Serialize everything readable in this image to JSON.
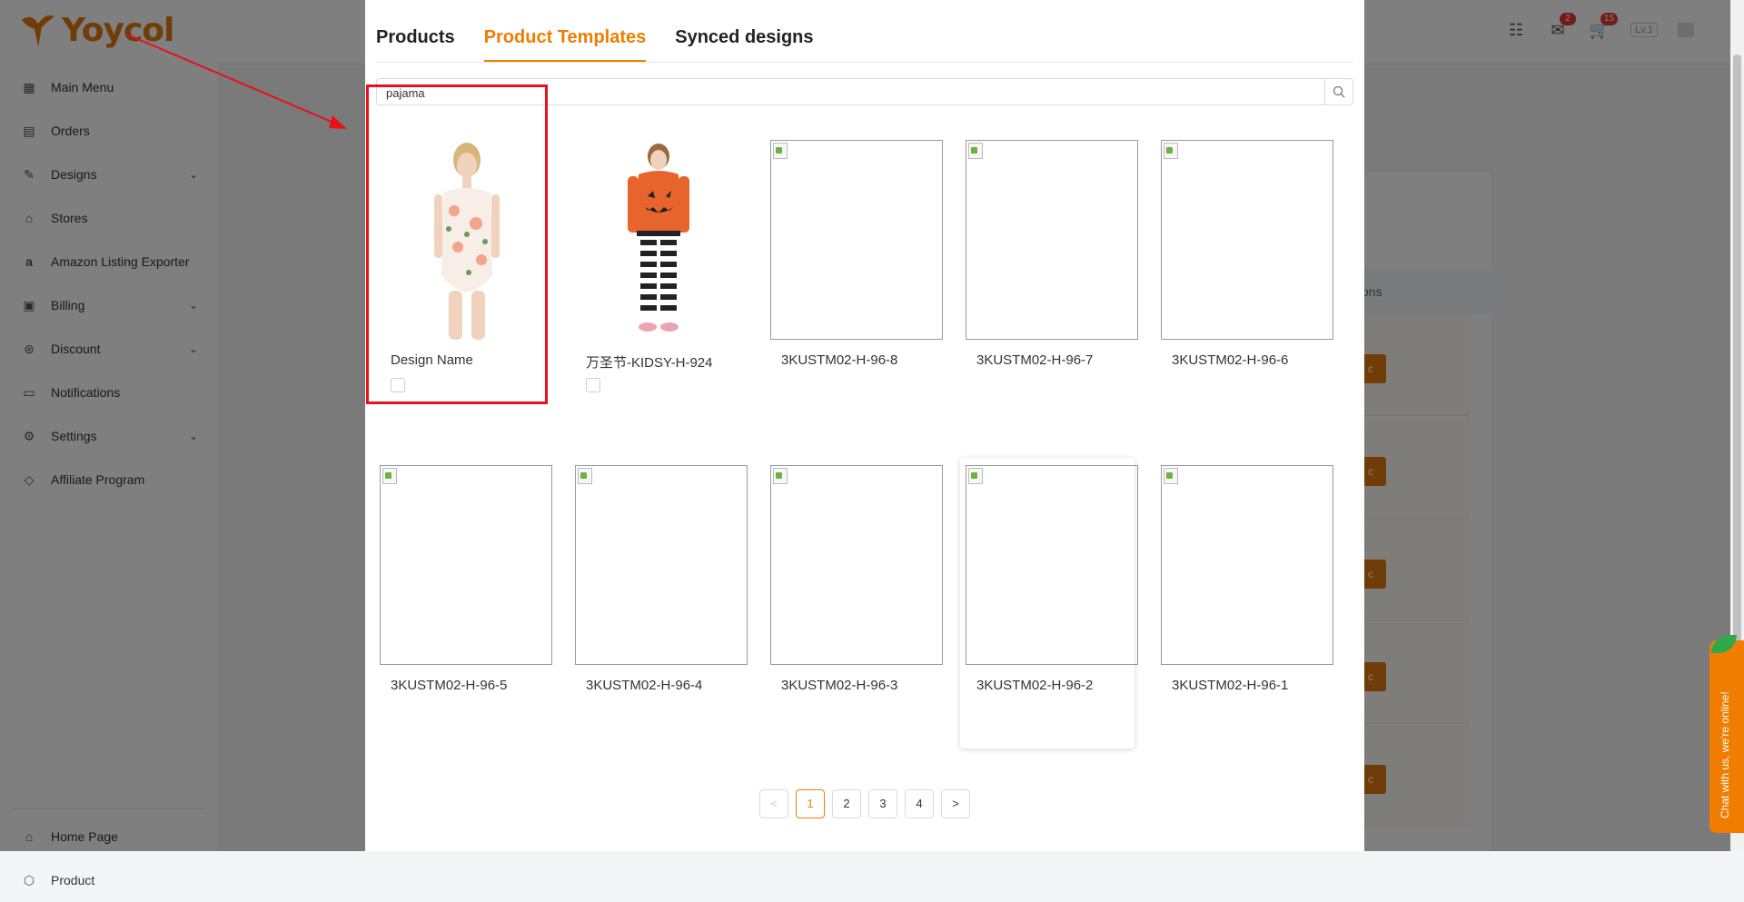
{
  "app": {
    "logo_text": "Yoycol",
    "brand_color": "#e07b10",
    "level_badge": "Lv.1",
    "messages_badge": "2",
    "cart_badge": "15"
  },
  "sidebar": {
    "items": [
      {
        "label": "Main Menu",
        "icon": "grid-icon"
      },
      {
        "label": "Orders",
        "icon": "clipboard-icon"
      },
      {
        "label": "Designs",
        "icon": "palette-icon",
        "expandable": true
      },
      {
        "label": "Stores",
        "icon": "store-icon"
      },
      {
        "label": "Amazon Listing Exporter",
        "icon": "amazon-icon"
      },
      {
        "label": "Billing",
        "icon": "billing-icon",
        "expandable": true
      },
      {
        "label": "Discount",
        "icon": "discount-icon",
        "expandable": true
      },
      {
        "label": "Notifications",
        "icon": "bell-icon"
      },
      {
        "label": "Settings",
        "icon": "gear-icon",
        "expandable": true
      },
      {
        "label": "Affiliate Program",
        "icon": "diamond-icon"
      }
    ],
    "bottom_items": [
      {
        "label": "Home Page",
        "icon": "home-icon"
      },
      {
        "label": "Product",
        "icon": "box-icon"
      }
    ]
  },
  "background": {
    "column_header_partial": "tions",
    "row_button_partial": "c"
  },
  "modal": {
    "tabs": [
      {
        "label": "Products",
        "active": false
      },
      {
        "label": "Product Templates",
        "active": true
      },
      {
        "label": "Synced designs",
        "active": false
      }
    ],
    "search": {
      "value": "pajama",
      "placeholder": ""
    },
    "templates": [
      {
        "name": "Design Name",
        "image": "swimsuit-photo",
        "checkbox": true
      },
      {
        "name": "万圣节-KIDSY-H-924",
        "image": "kids-pajama-photo",
        "checkbox": true
      },
      {
        "name": "3KUSTM02-H-96-8",
        "image": "broken-image"
      },
      {
        "name": "3KUSTM02-H-96-7",
        "image": "broken-image"
      },
      {
        "name": "3KUSTM02-H-96-6",
        "image": "broken-image"
      },
      {
        "name": "3KUSTM02-H-96-5",
        "image": "broken-image"
      },
      {
        "name": "3KUSTM02-H-96-4",
        "image": "broken-image"
      },
      {
        "name": "3KUSTM02-H-96-3",
        "image": "broken-image"
      },
      {
        "name": "3KUSTM02-H-96-2",
        "image": "broken-image",
        "hovered": true
      },
      {
        "name": "3KUSTM02-H-96-1",
        "image": "broken-image"
      }
    ],
    "pagination": {
      "prev": "<",
      "pages": [
        "1",
        "2",
        "3",
        "4"
      ],
      "current": "1",
      "next": ">"
    }
  },
  "chat_widget": {
    "label": "Chat with us, we're online!"
  },
  "accent_color": "#f07d00",
  "annotation_color": "#e8101a"
}
